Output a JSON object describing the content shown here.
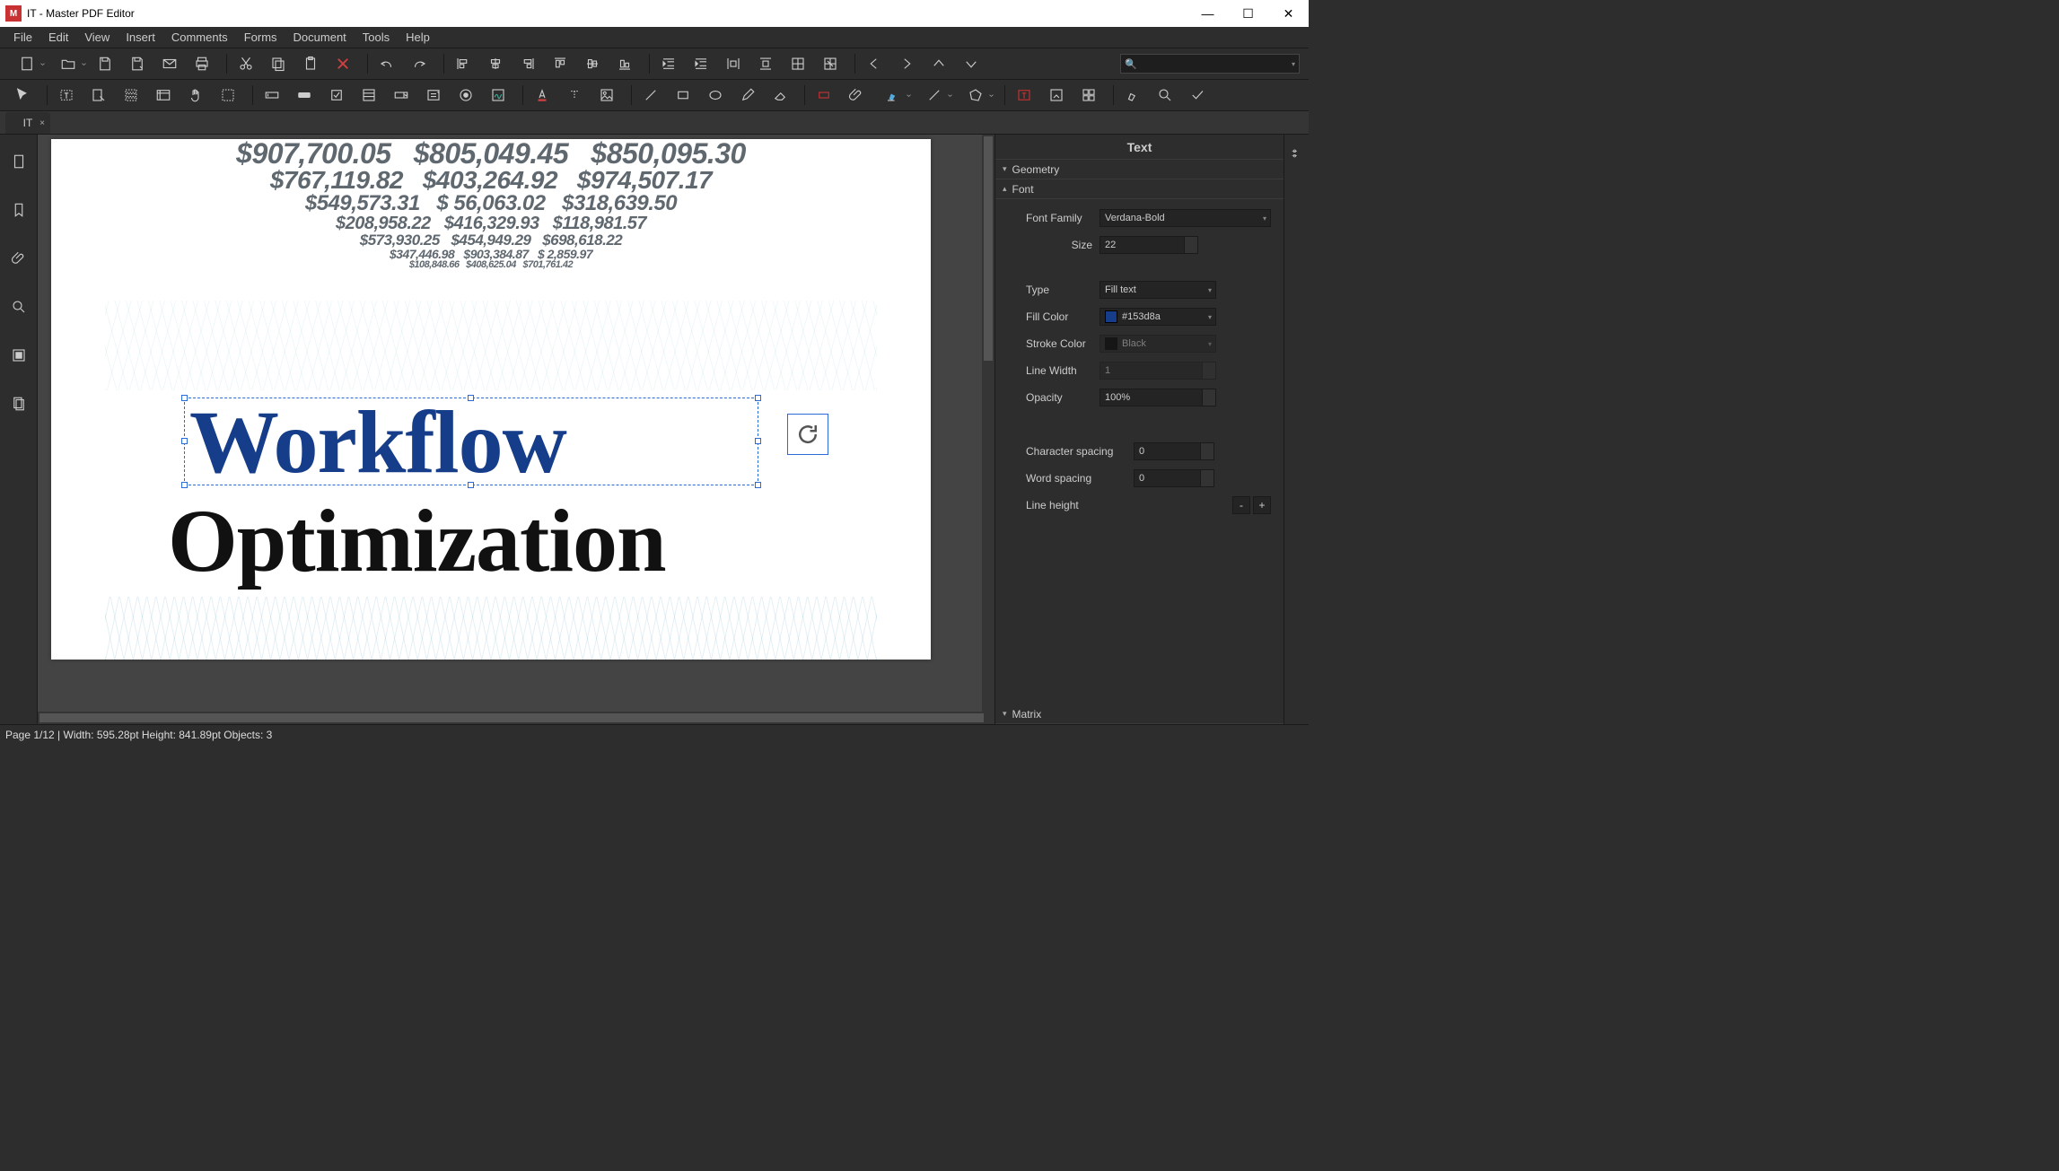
{
  "titlebar": {
    "title": "IT - Master PDF Editor"
  },
  "menu": [
    "File",
    "Edit",
    "View",
    "Insert",
    "Comments",
    "Forms",
    "Document",
    "Tools",
    "Help"
  ],
  "doctab": {
    "label": "IT"
  },
  "search": {
    "placeholder": "🔍"
  },
  "page_content": {
    "title_line1": "Workflow",
    "title_line2": "Optimization",
    "bg_numbers": [
      [
        "$907,700.05",
        "$805,049.45",
        "$850,095.30"
      ],
      [
        "$767,119.82",
        "$403,264.92",
        "$974,507.17"
      ],
      [
        "$549,573.31",
        "$ 56,063.02",
        "$318,639.50"
      ],
      [
        "$208,958.22",
        "$416,329.93",
        "$118,981.57"
      ],
      [
        "$573,930.25",
        "$454,949.29",
        "$698,618.22"
      ],
      [
        "$347,446.98",
        "$903,384.87",
        "$    2,859.97"
      ],
      [
        "$108,848.66",
        "$408,625.04",
        "$701,761.42"
      ]
    ]
  },
  "rightpanel": {
    "title": "Text",
    "sections": {
      "geometry": "Geometry",
      "font": "Font",
      "matrix": "Matrix"
    },
    "font": {
      "family_label": "Font Family",
      "family_value": "Verdana-Bold",
      "size_label": "Size",
      "size_value": "22",
      "type_label": "Type",
      "type_value": "Fill text",
      "fillcolor_label": "Fill Color",
      "fillcolor_value": "#153d8a",
      "fillcolor_swatch": "#153d8a",
      "strokecolor_label": "Stroke Color",
      "strokecolor_value": "Black",
      "strokecolor_swatch": "#000000",
      "linewidth_label": "Line Width",
      "linewidth_value": "1",
      "opacity_label": "Opacity",
      "opacity_value": "100%",
      "charspacing_label": "Character spacing",
      "charspacing_value": "0",
      "wordspacing_label": "Word spacing",
      "wordspacing_value": "0",
      "lineheight_label": "Line height"
    }
  },
  "statusbar": {
    "text": "Page 1/12 | Width: 595.28pt Height: 841.89pt Objects: 3"
  }
}
